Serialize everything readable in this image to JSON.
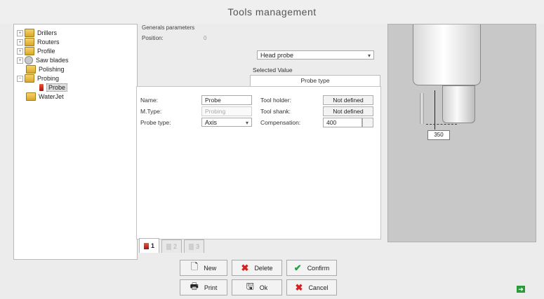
{
  "window": {
    "title": "Tools management"
  },
  "tree": {
    "items": [
      {
        "label": "Drillers",
        "expander": "+",
        "icon": "folder-icon"
      },
      {
        "label": "Routers",
        "expander": "+",
        "icon": "folder-icon"
      },
      {
        "label": "Profile",
        "expander": "+",
        "icon": "folder-icon"
      },
      {
        "label": "Saw blades",
        "expander": "+",
        "icon": "saw-blade-icon"
      },
      {
        "label": "Polishing",
        "expander": "",
        "icon": "folder-icon"
      },
      {
        "label": "Probing",
        "expander": "−",
        "icon": "folder-icon"
      },
      {
        "label": "Probe",
        "expander": "",
        "icon": "probe-icon"
      },
      {
        "label": "WaterJet",
        "expander": "",
        "icon": "folder-icon"
      }
    ]
  },
  "params": {
    "general_label": "Generals parameters",
    "position_label": "Position:",
    "position_value": "0",
    "head_select": "Head probe",
    "selected_value_label": "Selected Value",
    "probe_type_header": "Probe type"
  },
  "form": {
    "name_label": "Name:",
    "name_value": "Probe",
    "mtype_label": "M.Type:",
    "mtype_value": "Probing",
    "probetype_label": "Probe type:",
    "probetype_value": "Axis",
    "toolholder_label": "Tool holder:",
    "toolholder_value": "Not defined",
    "toolshank_label": "Tool shank:",
    "toolshank_value": "Not defined",
    "compensation_label": "Compensation:",
    "compensation_value": "400"
  },
  "tabs": [
    {
      "label": "1"
    },
    {
      "label": "2"
    },
    {
      "label": "3"
    }
  ],
  "preview": {
    "dimension_value": "350"
  },
  "buttons": {
    "new": "New",
    "delete": "Delete",
    "confirm": "Confirm",
    "print": "Print",
    "ok": "Ok",
    "cancel": "Cancel"
  },
  "colors": {
    "delete_x": "#d62020",
    "confirm_check": "#22a040"
  }
}
